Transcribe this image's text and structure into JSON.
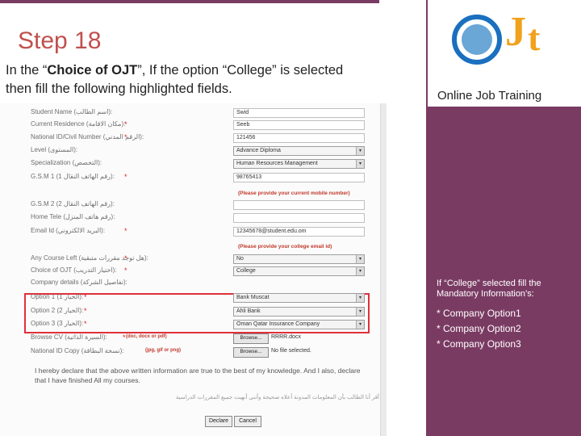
{
  "slide": {
    "title": "Step 18",
    "intro_part1": "In the “",
    "intro_bold": "Choice of OJT",
    "intro_part2": "”, If the option “College” is selected then fill the following highlighted fields.",
    "colors": {
      "background": "#7a3b63",
      "title": "#c0504d",
      "highlight": "#e0303a",
      "logo_orange": "#f0a21b",
      "logo_blue": "#1a6fbf"
    }
  },
  "logo": {
    "letters_j": "J",
    "letters_t": "t",
    "caption": "Online Job Training"
  },
  "form": {
    "rows": [
      {
        "label": "Student Name (اسم الطالب):",
        "value": "Swid",
        "kind": "input",
        "required": false
      },
      {
        "label": "Current Residence (مكان الاقامة):",
        "value": "Seeb",
        "kind": "input",
        "required": true
      },
      {
        "label": "National ID/Civil Number (الرقم المدني):",
        "value": "121456",
        "kind": "input",
        "required": true
      },
      {
        "label": "Level (المستوى):",
        "value": "Advance Diploma",
        "kind": "select",
        "required": false
      },
      {
        "label": "Specialization (التخصص):",
        "value": "Human Resources Management",
        "kind": "select",
        "required": false
      },
      {
        "label": "G.S.M 1 (رقم الهاتف النقال 1):",
        "value": "98765413",
        "kind": "input",
        "required": true
      },
      {
        "label": "G.S.M 2 (رقم الهاتف النقال 2):",
        "value": "",
        "kind": "input",
        "required": false
      },
      {
        "label": "Home Tele (رقم هاتف المنزل):",
        "value": "",
        "kind": "input",
        "required": false
      },
      {
        "label": "Email Id (البريد الالكتروني):",
        "value": "12345678@student.edu.om",
        "kind": "input",
        "required": true
      },
      {
        "label": "Any Course Left (هل توجد مقررات متبقية):",
        "value": "No",
        "kind": "select",
        "required": true
      },
      {
        "label": "Choice of OJT (اختيار التدريب):",
        "value": "College",
        "kind": "select",
        "required": true
      },
      {
        "label": "Company details (تفاصيل الشركة):",
        "value": "",
        "kind": "none",
        "required": false
      },
      {
        "label": "Option 1 (الخيار 1):",
        "value": "Bank Muscat",
        "kind": "select",
        "required": true
      },
      {
        "label": "Option 2 (الخيار 2):",
        "value": "Ahli Bank",
        "kind": "select",
        "required": true
      },
      {
        "label": "Option 3 (الخيار 3):",
        "value": "Oman Qatar Insurance Company",
        "kind": "select",
        "required": true
      },
      {
        "label": "Browse CV (السيرة الذاتية):",
        "value": "",
        "kind": "browse",
        "required": true
      },
      {
        "label": "National ID Copy (نسخة البطاقة):",
        "value": "",
        "kind": "browse",
        "required": false
      }
    ],
    "hint_mobile": "(Please provide your current mobile number)",
    "hint_email": "(Please provide your college email id)",
    "browse_label": "Browse...",
    "cv_file": "RRRR.docx",
    "id_file": "No file selected.",
    "cv_types": "(doc, docx or pdf)",
    "id_types": "(jpg, gif or png)",
    "declaration": "I hereby declare that the above written information are true to the best of my knowledge. And I also, declare that I have finished All my courses.",
    "declaration_ar": "أقر أنا الطالب بأن المعلومات المدونة أعلاه صحيحة وأنني أنهيت جميع المقررات الدراسية",
    "declare_button": "Declare",
    "cancel_button": "Cancel"
  },
  "side_note": {
    "heading": "If “College” selected fill the Mandatory Information’s:",
    "options": [
      "* Company Option1",
      "* Company Option2",
      "* Company Option3"
    ]
  }
}
